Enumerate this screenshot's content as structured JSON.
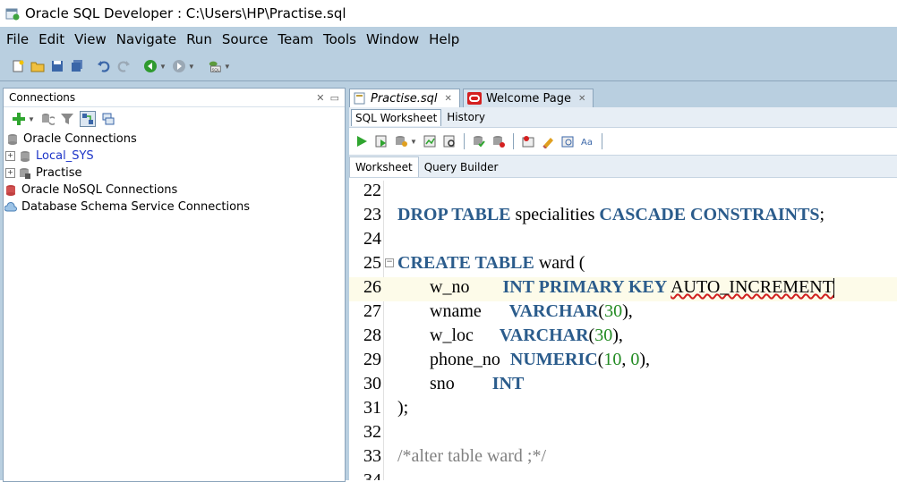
{
  "window": {
    "title": "Oracle SQL Developer : C:\\Users\\HP\\Practise.sql"
  },
  "menu": [
    "File",
    "Edit",
    "View",
    "Navigate",
    "Run",
    "Source",
    "Team",
    "Tools",
    "Window",
    "Help"
  ],
  "connections_panel": {
    "title": "Connections",
    "items": [
      {
        "label": "Oracle Connections",
        "icon": "database-icon",
        "expandable": false
      },
      {
        "label": "Local_SYS",
        "icon": "database-connection-icon",
        "expandable": true
      },
      {
        "label": "Practise",
        "icon": "database-connection-icon",
        "expandable": true
      },
      {
        "label": "Oracle NoSQL Connections",
        "icon": "nosql-icon",
        "expandable": false
      },
      {
        "label": "Database Schema Service Connections",
        "icon": "cloud-icon",
        "expandable": false
      }
    ]
  },
  "doc_tabs": [
    {
      "label": "Practise.sql",
      "active": true
    },
    {
      "label": "Welcome Page",
      "active": false
    }
  ],
  "sub_tabs": [
    "SQL Worksheet",
    "History"
  ],
  "worksheet_tabs": [
    "Worksheet",
    "Query Builder"
  ],
  "editor": {
    "line_numbers": [
      "22",
      "23",
      "24",
      "25",
      "26",
      "27",
      "28",
      "29",
      "30",
      "31",
      "32",
      "33",
      "34"
    ],
    "line23": {
      "kw1": "DROP TABLE",
      "name": " specialities ",
      "kw2": "CASCADE CONSTRAINTS",
      "end": ";"
    },
    "line25": {
      "kw": "CREATE TABLE",
      "rest": " ward ("
    },
    "line26": {
      "col": "w_no",
      "kw": "INT PRIMARY KEY",
      "err": "AUTO_INCREMENT"
    },
    "line27": {
      "col": "wname",
      "kw": "VARCHAR",
      "open": "(",
      "num": "30",
      "close": "),"
    },
    "line28": {
      "col": "w_loc",
      "kw": "VARCHAR",
      "open": "(",
      "num": "30",
      "close": "),"
    },
    "line29": {
      "col": "phone_no",
      "kw": "NUMERIC",
      "open": "(",
      "num1": "10",
      "comma": ", ",
      "num2": "0",
      "close": "),"
    },
    "line30": {
      "col": "sno",
      "kw": "INT"
    },
    "line31": ");",
    "line33": "/*alter table ward ;*/"
  },
  "colors": {
    "menubar": "#b9cfe0",
    "keyword": "#2b5c8c",
    "number": "#228b22",
    "comment": "#808080",
    "link": "#1d35c8"
  }
}
